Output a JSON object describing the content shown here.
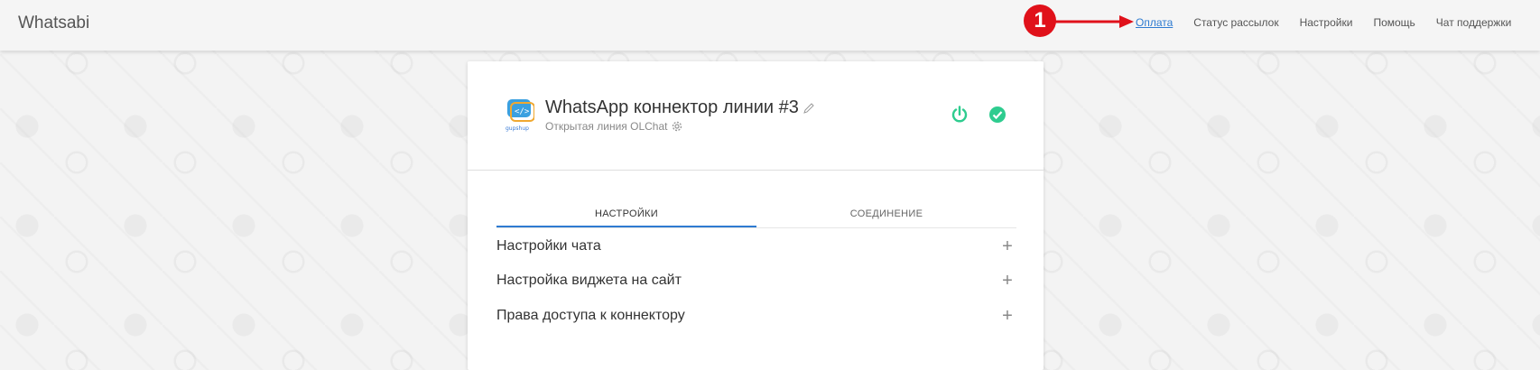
{
  "app": {
    "brand": "Whatsabi"
  },
  "nav": {
    "items": [
      {
        "label": "Оплата"
      },
      {
        "label": "Статус рассылок"
      },
      {
        "label": "Настройки"
      },
      {
        "label": "Помощь"
      },
      {
        "label": "Чат поддержки"
      }
    ]
  },
  "annotation": {
    "marker": "1",
    "color": "#e0111a"
  },
  "connector": {
    "title": "WhatsApp коннектор линии #3",
    "subtitle": "Открытая линия OLChat",
    "logo_text": "gupshup",
    "status_power_color": "#2ecc8f",
    "status_check_color": "#2ecc8f"
  },
  "tabs": [
    {
      "label": "НАСТРОЙКИ",
      "active": true
    },
    {
      "label": "СОЕДИНЕНИЕ",
      "active": false
    }
  ],
  "accordion": [
    {
      "label": "Настройки чата"
    },
    {
      "label": "Настройка виджета на сайт"
    },
    {
      "label": "Права доступа к коннектору"
    }
  ],
  "colors": {
    "accent": "#2e7bd1"
  }
}
